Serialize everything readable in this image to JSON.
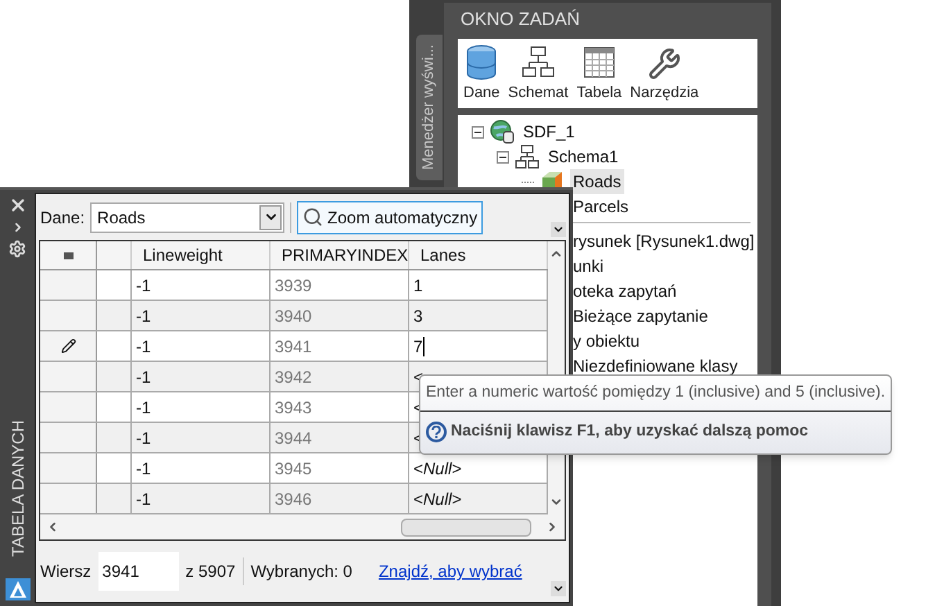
{
  "task_pane": {
    "side_tab": "Menedżer wyświ...",
    "title": "OKNO ZADAŃ",
    "toolbar": [
      {
        "kind": "data",
        "label": "Dane"
      },
      {
        "kind": "schema",
        "label": "Schemat"
      },
      {
        "kind": "table",
        "label": "Tabela"
      },
      {
        "kind": "tools",
        "label": "Narzędzia"
      }
    ],
    "tree": [
      {
        "label": "SDF_1",
        "kind": "database",
        "expanded": true,
        "selected": false,
        "children": [
          {
            "label": "Schema1",
            "kind": "schema",
            "expanded": true,
            "selected": false,
            "children": [
              {
                "label": "Roads",
                "kind": "class",
                "selected": true
              },
              {
                "label": "Parcels",
                "selected": false
              }
            ]
          }
        ]
      }
    ],
    "partial_items": [
      "rysunek [Rysunek1.dwg]",
      "unki",
      "oteka zapytań",
      "Bieżące zapytanie",
      "y obiektu",
      "Niezdefiniowane klasy"
    ]
  },
  "data_table": {
    "side_title": "TABELA DANYCH",
    "data_label": "Dane:",
    "data_value": "Roads",
    "zoom_button": "Zoom automatyczny",
    "columns": [
      "Lineweight",
      "PRIMARYINDEX",
      "Lanes"
    ],
    "rows": [
      {
        "cells": [
          "-1",
          "3939",
          "1"
        ],
        "editing": false
      },
      {
        "cells": [
          "-1",
          "3940",
          "3"
        ],
        "editing": false
      },
      {
        "cells": [
          "-1",
          "3941",
          "7"
        ],
        "editing": true
      },
      {
        "cells": [
          "-1",
          "3942",
          "<"
        ],
        "editing": false
      },
      {
        "cells": [
          "-1",
          "3943",
          "<"
        ],
        "editing": false
      },
      {
        "cells": [
          "-1",
          "3944",
          "<"
        ],
        "editing": false
      },
      {
        "cells": [
          "-1",
          "3945",
          "<*Null*>"
        ],
        "editing": false
      },
      {
        "cells": [
          "-1",
          "3946",
          "<*Null*>"
        ],
        "editing": false
      }
    ],
    "status": {
      "row_label": "Wiersz",
      "row_value": "3941",
      "total": "z 5907",
      "selected": "Wybranych: 0",
      "link": "Znajdź, aby wybrać"
    }
  },
  "tooltip": {
    "message": "Enter a numeric wartość pomiędzy 1 (inclusive) and 5 (inclusive).",
    "help": "Naciśnij klawisz F1, aby uzyskać dalszą pomoc"
  }
}
